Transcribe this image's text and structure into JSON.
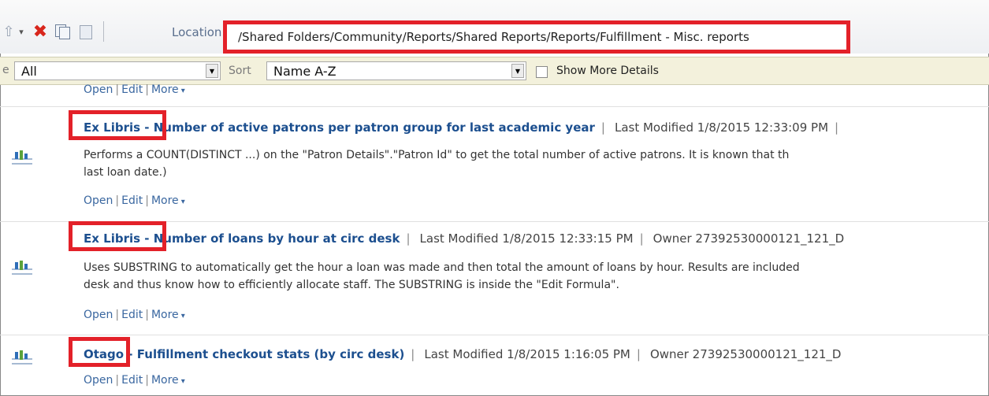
{
  "toolbar": {
    "icons": [
      "up-arrow-icon",
      "chevron-down-icon",
      "delete-icon",
      "copy-icon",
      "paste-icon"
    ],
    "location_label": "Location",
    "location_path": "/Shared Folders/Community/Reports/Shared Reports/Reports/Fulfillment - Misc. reports"
  },
  "filterbar": {
    "left_stub": "e",
    "type_value": "All",
    "sort_label": "Sort",
    "sort_value": "Name A-Z",
    "show_more_label": "Show More Details",
    "show_more_checked": false
  },
  "top_links": {
    "open": "Open",
    "edit": "Edit",
    "more": "More"
  },
  "reports": [
    {
      "prefix": "Ex Libris - ",
      "title": "Number of active patrons per patron group for last academic year",
      "last_modified": "Last Modified 1/8/2015 12:33:09 PM",
      "owner": "",
      "description_lines": [
        "Performs a COUNT(DISTINCT ...) on the \"Patron Details\".\"Patron Id\" to get the total number of active patrons. It is known that th",
        "last loan date.)"
      ],
      "links": {
        "open": "Open",
        "edit": "Edit",
        "more": "More"
      }
    },
    {
      "prefix": "Ex Libris - ",
      "title": "Number of loans by hour at circ desk",
      "last_modified": "Last Modified 1/8/2015 12:33:15 PM",
      "owner": "Owner 27392530000121_121_D",
      "description_lines": [
        "Uses SUBSTRING to automatically get the hour a loan was made and then total the amount of loans by hour. Results are included",
        "desk and thus know how to efficiently allocate staff. The SUBSTRING is inside the \"Edit Formula\"."
      ],
      "links": {
        "open": "Open",
        "edit": "Edit",
        "more": "More"
      }
    },
    {
      "prefix": "Otago - ",
      "title": "Fulfillment checkout stats (by circ desk)",
      "last_modified": "Last Modified 1/8/2015 1:16:05 PM",
      "owner": "Owner 27392530000121_121_D",
      "description_lines": [],
      "links": {
        "open": "Open",
        "edit": "Edit",
        "more": "More"
      }
    }
  ],
  "colors": {
    "highlight_box": "#e32129",
    "link": "#3a67a0",
    "title": "#1c4f8f",
    "filterbar_bg": "#f3f1dc"
  }
}
